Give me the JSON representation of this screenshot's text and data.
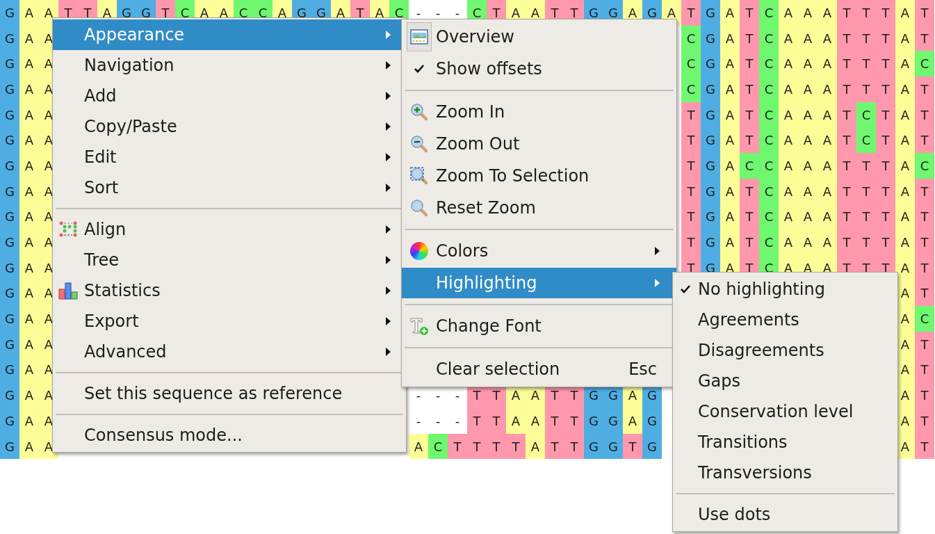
{
  "alignment": {
    "rows": [
      [
        "G",
        "A",
        "A",
        "T",
        "T",
        "A",
        "G",
        "G",
        "T",
        "C",
        "A",
        "A",
        "C",
        "C",
        "A",
        "G",
        "G",
        "A",
        "T",
        "A",
        "C",
        "-",
        "-",
        "-",
        "C",
        "T",
        "A",
        "A",
        "T",
        "T",
        "G",
        "G",
        "A",
        "G",
        "A",
        "T",
        "G",
        "A",
        "T",
        "C",
        "A",
        "A",
        "A",
        "T",
        "T",
        "T",
        "A",
        "T"
      ],
      [
        "G",
        "A",
        "A",
        null,
        null,
        null,
        null,
        null,
        null,
        null,
        null,
        null,
        null,
        null,
        null,
        null,
        null,
        null,
        null,
        null,
        null,
        null,
        null,
        null,
        null,
        null,
        null,
        null,
        null,
        null,
        null,
        null,
        null,
        null,
        null,
        "C",
        "G",
        "A",
        "T",
        "C",
        "A",
        "A",
        "A",
        "T",
        "T",
        "T",
        "A",
        "T"
      ],
      [
        "G",
        "A",
        "A",
        null,
        null,
        null,
        null,
        null,
        null,
        null,
        null,
        null,
        null,
        null,
        null,
        null,
        null,
        null,
        null,
        null,
        null,
        null,
        null,
        null,
        null,
        null,
        null,
        null,
        null,
        null,
        null,
        null,
        null,
        null,
        null,
        "C",
        "G",
        "A",
        "T",
        "C",
        "A",
        "A",
        "A",
        "T",
        "T",
        "T",
        "A",
        "C"
      ],
      [
        "G",
        "A",
        "A",
        null,
        null,
        null,
        null,
        null,
        null,
        null,
        null,
        null,
        null,
        null,
        null,
        null,
        null,
        null,
        null,
        null,
        null,
        null,
        null,
        null,
        null,
        null,
        null,
        null,
        null,
        null,
        null,
        null,
        null,
        null,
        null,
        "C",
        "G",
        "A",
        "T",
        "C",
        "A",
        "A",
        "A",
        "T",
        "T",
        "T",
        "A",
        "T"
      ],
      [
        "G",
        "A",
        "A",
        null,
        null,
        null,
        null,
        null,
        null,
        null,
        null,
        null,
        null,
        null,
        null,
        null,
        null,
        null,
        null,
        null,
        null,
        null,
        null,
        null,
        null,
        null,
        null,
        null,
        null,
        null,
        null,
        null,
        null,
        null,
        null,
        "T",
        "G",
        "A",
        "T",
        "C",
        "A",
        "A",
        "A",
        "T",
        "C",
        "T",
        "A",
        "T"
      ],
      [
        "G",
        "A",
        "A",
        null,
        null,
        null,
        null,
        null,
        null,
        null,
        null,
        null,
        null,
        null,
        null,
        null,
        null,
        null,
        null,
        null,
        null,
        null,
        null,
        null,
        null,
        null,
        null,
        null,
        null,
        null,
        null,
        null,
        null,
        null,
        null,
        "T",
        "G",
        "A",
        "T",
        "C",
        "A",
        "A",
        "A",
        "T",
        "C",
        "T",
        "A",
        "T"
      ],
      [
        "G",
        "A",
        "A",
        null,
        null,
        null,
        null,
        null,
        null,
        null,
        null,
        null,
        null,
        null,
        null,
        null,
        null,
        null,
        null,
        null,
        null,
        null,
        null,
        null,
        null,
        null,
        null,
        null,
        null,
        null,
        null,
        null,
        null,
        null,
        null,
        "T",
        "G",
        "A",
        "C",
        "C",
        "A",
        "A",
        "A",
        "T",
        "T",
        "T",
        "A",
        "C"
      ],
      [
        "G",
        "A",
        "A",
        null,
        null,
        null,
        null,
        null,
        null,
        null,
        null,
        null,
        null,
        null,
        null,
        null,
        null,
        null,
        null,
        null,
        null,
        null,
        null,
        null,
        null,
        null,
        null,
        null,
        null,
        null,
        null,
        null,
        null,
        null,
        null,
        "T",
        "G",
        "A",
        "T",
        "C",
        "A",
        "A",
        "A",
        "T",
        "T",
        "T",
        "A",
        "T"
      ],
      [
        "G",
        "A",
        "A",
        null,
        null,
        null,
        null,
        null,
        null,
        null,
        null,
        null,
        null,
        null,
        null,
        null,
        null,
        null,
        null,
        null,
        null,
        null,
        null,
        null,
        null,
        null,
        null,
        null,
        null,
        null,
        null,
        null,
        null,
        null,
        null,
        "T",
        "G",
        "A",
        "T",
        "C",
        "A",
        "A",
        "A",
        "T",
        "T",
        "T",
        "A",
        "T"
      ],
      [
        "G",
        "A",
        "A",
        null,
        null,
        null,
        null,
        null,
        null,
        null,
        null,
        null,
        null,
        null,
        null,
        null,
        null,
        null,
        null,
        null,
        null,
        null,
        null,
        null,
        null,
        null,
        null,
        null,
        null,
        null,
        null,
        null,
        null,
        null,
        null,
        "T",
        "G",
        "A",
        "T",
        "C",
        "A",
        "A",
        "A",
        "T",
        "T",
        "T",
        "A",
        "T"
      ],
      [
        "G",
        "A",
        "A",
        null,
        null,
        null,
        null,
        null,
        null,
        null,
        null,
        null,
        null,
        null,
        null,
        null,
        null,
        null,
        null,
        null,
        null,
        null,
        null,
        null,
        null,
        null,
        null,
        null,
        null,
        null,
        null,
        null,
        null,
        null,
        null,
        "T",
        "G",
        "A",
        "T",
        "C",
        "A",
        "A",
        "A",
        "T",
        "T",
        "T",
        "A",
        "T"
      ],
      [
        "G",
        "A",
        "A",
        null,
        null,
        null,
        null,
        null,
        null,
        null,
        null,
        null,
        null,
        null,
        null,
        null,
        null,
        null,
        null,
        null,
        null,
        null,
        null,
        null,
        null,
        null,
        null,
        null,
        null,
        null,
        null,
        null,
        null,
        null,
        null,
        null,
        null,
        null,
        null,
        null,
        null,
        null,
        null,
        null,
        null,
        null,
        "A",
        "T"
      ],
      [
        "G",
        "A",
        "A",
        null,
        null,
        null,
        null,
        null,
        null,
        null,
        null,
        null,
        null,
        null,
        null,
        null,
        null,
        null,
        null,
        null,
        null,
        null,
        null,
        null,
        null,
        null,
        null,
        null,
        null,
        null,
        null,
        null,
        null,
        null,
        null,
        null,
        null,
        null,
        null,
        null,
        null,
        null,
        null,
        null,
        null,
        null,
        "A",
        "C"
      ],
      [
        "G",
        "A",
        "A",
        null,
        null,
        null,
        null,
        null,
        null,
        null,
        null,
        null,
        null,
        null,
        null,
        null,
        null,
        null,
        null,
        null,
        null,
        null,
        null,
        null,
        null,
        null,
        null,
        null,
        null,
        null,
        null,
        null,
        null,
        null,
        null,
        null,
        null,
        null,
        null,
        null,
        null,
        null,
        null,
        null,
        null,
        null,
        "A",
        "T"
      ],
      [
        "G",
        "A",
        "A",
        null,
        null,
        null,
        null,
        null,
        null,
        null,
        null,
        null,
        null,
        null,
        null,
        null,
        null,
        null,
        null,
        null,
        null,
        null,
        null,
        null,
        null,
        null,
        null,
        null,
        null,
        null,
        null,
        null,
        null,
        null,
        null,
        null,
        null,
        null,
        null,
        null,
        null,
        null,
        null,
        null,
        null,
        null,
        "A",
        "T"
      ],
      [
        "G",
        "A",
        "A",
        null,
        null,
        null,
        null,
        null,
        null,
        null,
        null,
        null,
        null,
        null,
        null,
        null,
        null,
        null,
        null,
        null,
        null,
        "-",
        "-",
        "-",
        "T",
        "T",
        "A",
        "A",
        "T",
        "T",
        "G",
        "G",
        "A",
        "G",
        null,
        null,
        null,
        null,
        null,
        null,
        null,
        null,
        null,
        null,
        null,
        null,
        "A",
        "T"
      ],
      [
        "G",
        "A",
        "A",
        null,
        null,
        null,
        null,
        null,
        null,
        null,
        null,
        null,
        null,
        null,
        null,
        null,
        null,
        null,
        null,
        null,
        null,
        "-",
        "-",
        "-",
        "T",
        "T",
        "A",
        "A",
        "T",
        "T",
        "G",
        "G",
        "A",
        "G",
        null,
        null,
        null,
        null,
        null,
        null,
        null,
        null,
        null,
        null,
        null,
        null,
        "A",
        "T"
      ],
      [
        "G",
        "A",
        "A",
        null,
        null,
        null,
        null,
        null,
        null,
        null,
        null,
        null,
        null,
        null,
        null,
        null,
        null,
        null,
        null,
        null,
        null,
        "A",
        "C",
        "T",
        "T",
        "T",
        "T",
        "A",
        "T",
        "T",
        "G",
        "G",
        "T",
        "G",
        null,
        null,
        null,
        null,
        null,
        null,
        null,
        null,
        null,
        null,
        null,
        null,
        "A",
        "T"
      ]
    ]
  },
  "context_menu": {
    "items": [
      {
        "kind": "item",
        "label": "Appearance",
        "selected": true,
        "submenu": true
      },
      {
        "kind": "item",
        "label": "Navigation",
        "selected": false,
        "submenu": true
      },
      {
        "kind": "item",
        "label": "Add",
        "selected": false,
        "submenu": true
      },
      {
        "kind": "item",
        "label": "Copy/Paste",
        "selected": false,
        "submenu": true
      },
      {
        "kind": "item",
        "label": "Edit",
        "selected": false,
        "submenu": true
      },
      {
        "kind": "item",
        "label": "Sort",
        "selected": false,
        "submenu": true
      },
      {
        "kind": "separator"
      },
      {
        "kind": "item",
        "label": "Align",
        "selected": false,
        "submenu": true
      },
      {
        "kind": "item",
        "label": "Tree",
        "selected": false,
        "submenu": true
      },
      {
        "kind": "item",
        "label": "Statistics",
        "selected": false,
        "submenu": true
      },
      {
        "kind": "item",
        "label": "Export",
        "selected": false,
        "submenu": true
      },
      {
        "kind": "item",
        "label": "Advanced",
        "selected": false,
        "submenu": true
      },
      {
        "kind": "separator"
      },
      {
        "kind": "item",
        "label": "Set this sequence as reference",
        "selected": false,
        "submenu": false
      },
      {
        "kind": "separator"
      },
      {
        "kind": "item",
        "label": "Consensus mode...",
        "selected": false,
        "submenu": false
      }
    ]
  },
  "appearance_submenu": {
    "items": [
      {
        "kind": "item",
        "label": "Overview",
        "selected": false,
        "submenu": false,
        "checked": true
      },
      {
        "kind": "item",
        "label": "Show offsets",
        "selected": false,
        "submenu": false,
        "checked": true
      },
      {
        "kind": "separator"
      },
      {
        "kind": "item",
        "label": "Zoom In",
        "selected": false,
        "submenu": false,
        "checked": false
      },
      {
        "kind": "item",
        "label": "Zoom Out",
        "selected": false,
        "submenu": false,
        "checked": false
      },
      {
        "kind": "item",
        "label": "Zoom To Selection",
        "selected": false,
        "submenu": false,
        "checked": false
      },
      {
        "kind": "item",
        "label": "Reset Zoom",
        "selected": false,
        "submenu": false,
        "checked": false
      },
      {
        "kind": "separator"
      },
      {
        "kind": "item",
        "label": "Colors",
        "selected": false,
        "submenu": true,
        "checked": false
      },
      {
        "kind": "item",
        "label": "Highlighting",
        "selected": true,
        "submenu": true,
        "checked": false
      },
      {
        "kind": "separator"
      },
      {
        "kind": "item",
        "label": "Change Font",
        "selected": false,
        "submenu": false,
        "checked": false
      },
      {
        "kind": "separator"
      },
      {
        "kind": "item",
        "label": "Clear selection",
        "shortcut": "Esc",
        "selected": false,
        "submenu": false,
        "checked": false
      }
    ]
  },
  "highlighting_submenu": {
    "items": [
      {
        "kind": "item",
        "label": "No highlighting",
        "selected": false,
        "checked": true
      },
      {
        "kind": "item",
        "label": "Agreements",
        "selected": false,
        "checked": false
      },
      {
        "kind": "item",
        "label": "Disagreements",
        "selected": false,
        "checked": false
      },
      {
        "kind": "item",
        "label": "Gaps",
        "selected": false,
        "checked": false
      },
      {
        "kind": "item",
        "label": "Conservation level",
        "selected": false,
        "checked": false
      },
      {
        "kind": "item",
        "label": "Transitions",
        "selected": false,
        "checked": false
      },
      {
        "kind": "item",
        "label": "Transversions",
        "selected": false,
        "checked": false
      },
      {
        "kind": "separator"
      },
      {
        "kind": "item",
        "label": "Use dots",
        "selected": false,
        "checked": false
      }
    ]
  }
}
